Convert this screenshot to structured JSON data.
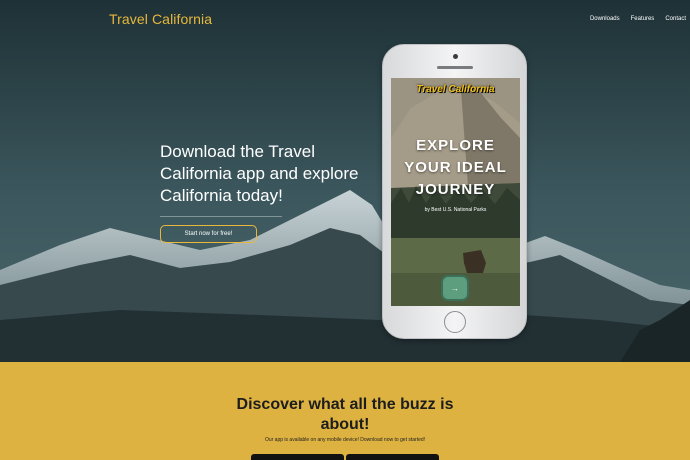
{
  "header": {
    "brand": "Travel California",
    "nav": [
      "Downloads",
      "Features",
      "Contact"
    ]
  },
  "hero": {
    "headline": "Download the Travel California app and explore California today!",
    "cta_label": "Start now for free!"
  },
  "phone_app": {
    "brand": "Travel California",
    "title_line1": "EXPLORE",
    "title_line2": "YOUR IDEAL",
    "title_line3": "JOURNEY",
    "subtitle": "by Best U.S. National Parks",
    "go_icon": "arrow-right-icon",
    "go_glyph": "→"
  },
  "section": {
    "title": "Discover what all the buzz is about!",
    "subtitle": "Our app is available on any mobile device! Download now to get started!"
  },
  "colors": {
    "accent": "#e8b83c",
    "section_bg": "#ddb241",
    "go_button": "#5c9e7e"
  }
}
